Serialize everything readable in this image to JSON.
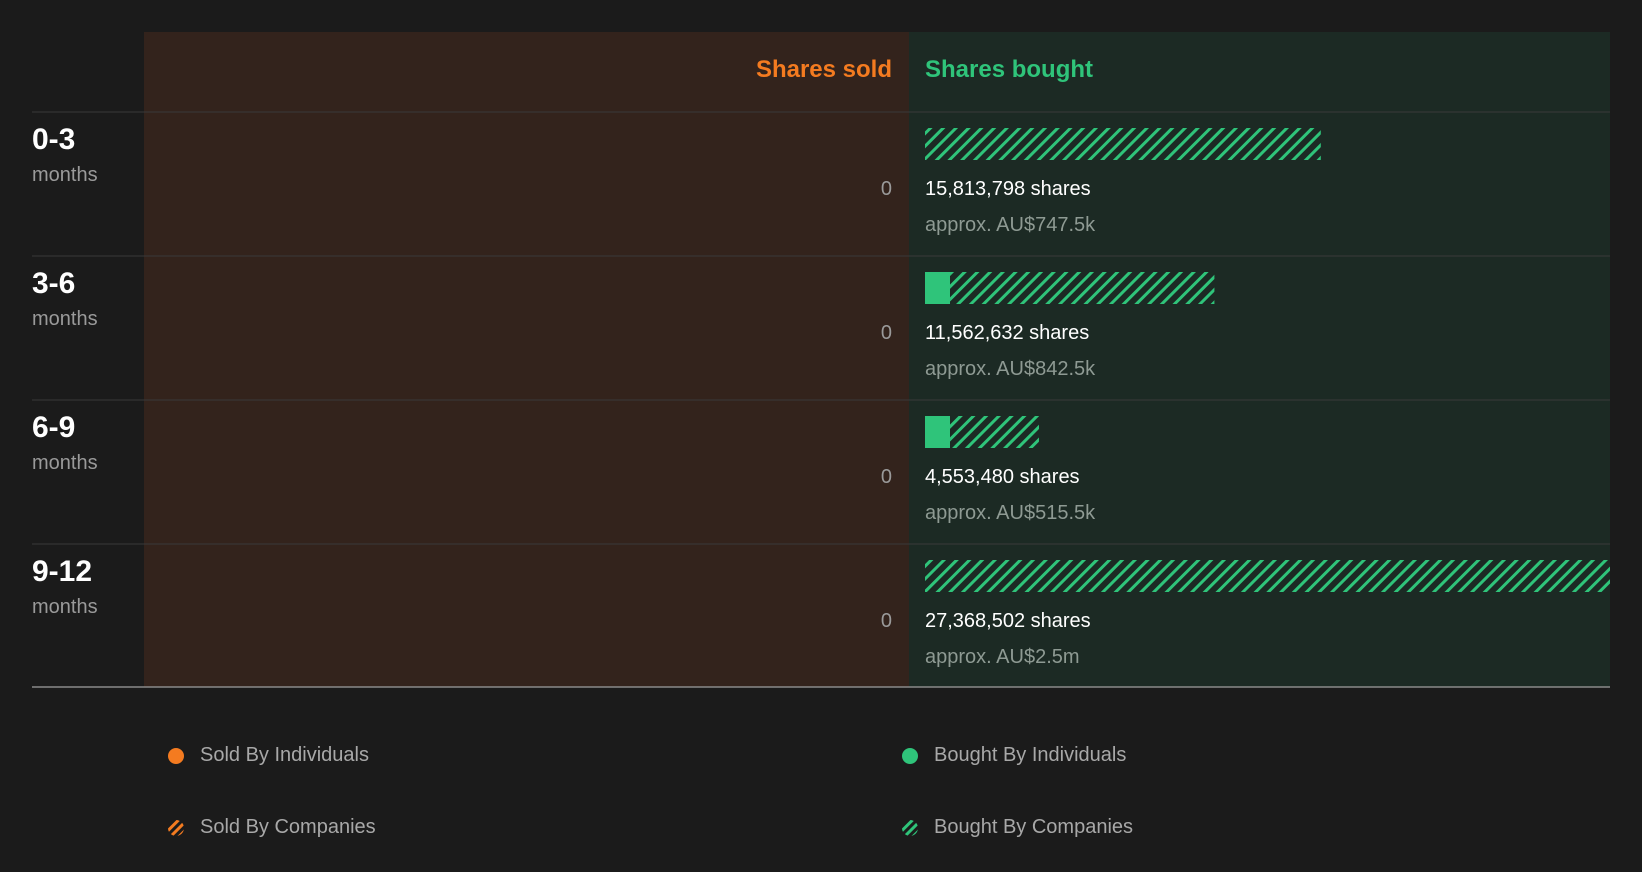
{
  "header": {
    "sold_label": "Shares sold",
    "bought_label": "Shares bought"
  },
  "colors": {
    "background": "#1b1b1b",
    "sold_panel": "#33231c",
    "bought_panel": "#1c2a24",
    "sold_accent": "#f47b20",
    "bought_accent": "#2fc47a"
  },
  "rows": [
    {
      "range": "0-3",
      "unit": "months",
      "sold": "0",
      "bought_shares": "15,813,798 shares",
      "bought_value": "approx. AU$747.5k"
    },
    {
      "range": "3-6",
      "unit": "months",
      "sold": "0",
      "bought_shares": "11,562,632 shares",
      "bought_value": "approx. AU$842.5k"
    },
    {
      "range": "6-9",
      "unit": "months",
      "sold": "0",
      "bought_shares": "4,553,480 shares",
      "bought_value": "approx. AU$515.5k"
    },
    {
      "range": "9-12",
      "unit": "months",
      "sold": "0",
      "bought_shares": "27,368,502 shares",
      "bought_value": "approx. AU$2.5m"
    }
  ],
  "legend": {
    "sold_individuals": "Sold By Individuals",
    "sold_companies": "Sold By Companies",
    "bought_individuals": "Bought By Individuals",
    "bought_companies": "Bought By Companies"
  },
  "chart_data": {
    "type": "bar",
    "orientation": "horizontal",
    "stacked": true,
    "categories": [
      "0-3 months",
      "3-6 months",
      "6-9 months",
      "9-12 months"
    ],
    "series": [
      {
        "name": "Sold By Individuals",
        "values": [
          0,
          0,
          0,
          0
        ]
      },
      {
        "name": "Sold By Companies",
        "values": [
          0,
          0,
          0,
          0
        ]
      },
      {
        "name": "Bought By Individuals",
        "values": [
          0,
          1000000,
          1000000,
          0
        ]
      },
      {
        "name": "Bought By Companies",
        "values": [
          15813798,
          10562632,
          3553480,
          27368502
        ]
      }
    ],
    "totals_bought": [
      15813798,
      11562632,
      4553480,
      27368502
    ],
    "totals_sold": [
      0,
      0,
      0,
      0
    ],
    "xlim": [
      0,
      27368502
    ],
    "legend_position": "bottom"
  }
}
